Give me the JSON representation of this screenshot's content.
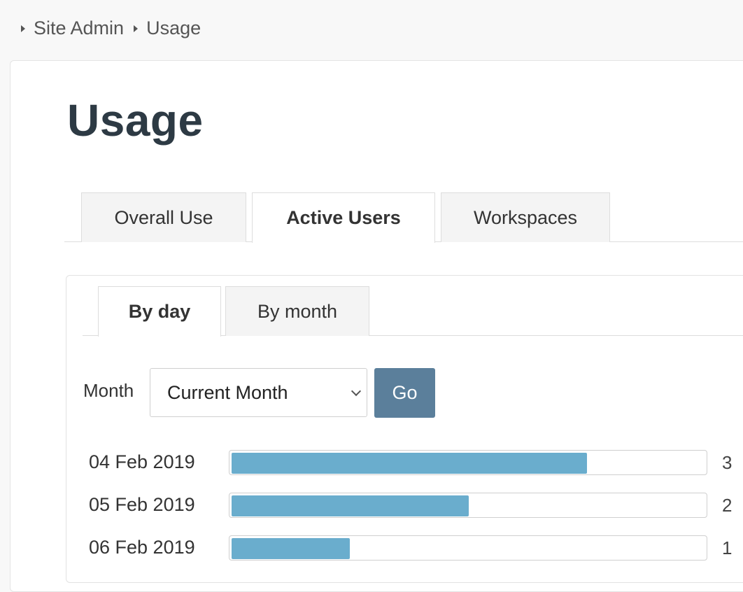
{
  "breadcrumb": {
    "items": [
      "Site Admin",
      "Usage"
    ]
  },
  "page": {
    "title": "Usage"
  },
  "tabs": [
    {
      "label": "Overall Use",
      "active": false
    },
    {
      "label": "Active Users",
      "active": true
    },
    {
      "label": "Workspaces",
      "active": false
    }
  ],
  "subtabs": [
    {
      "label": "By day",
      "active": true
    },
    {
      "label": "By month",
      "active": false
    }
  ],
  "filter": {
    "label": "Month",
    "selected": "Current Month",
    "go_label": "Go"
  },
  "colors": {
    "accent_bar": "#6aadcd",
    "go_button": "#5b7f9b",
    "title": "#2d3a44"
  },
  "icons": {
    "breadcrumb_separator": "caret-right-icon",
    "select_arrow": "chevron-down-icon"
  },
  "chart_data": {
    "type": "bar",
    "categories": [
      "04 Feb 2019",
      "05 Feb 2019",
      "06 Feb 2019"
    ],
    "values": [
      3,
      2,
      1
    ],
    "max": 4
  }
}
